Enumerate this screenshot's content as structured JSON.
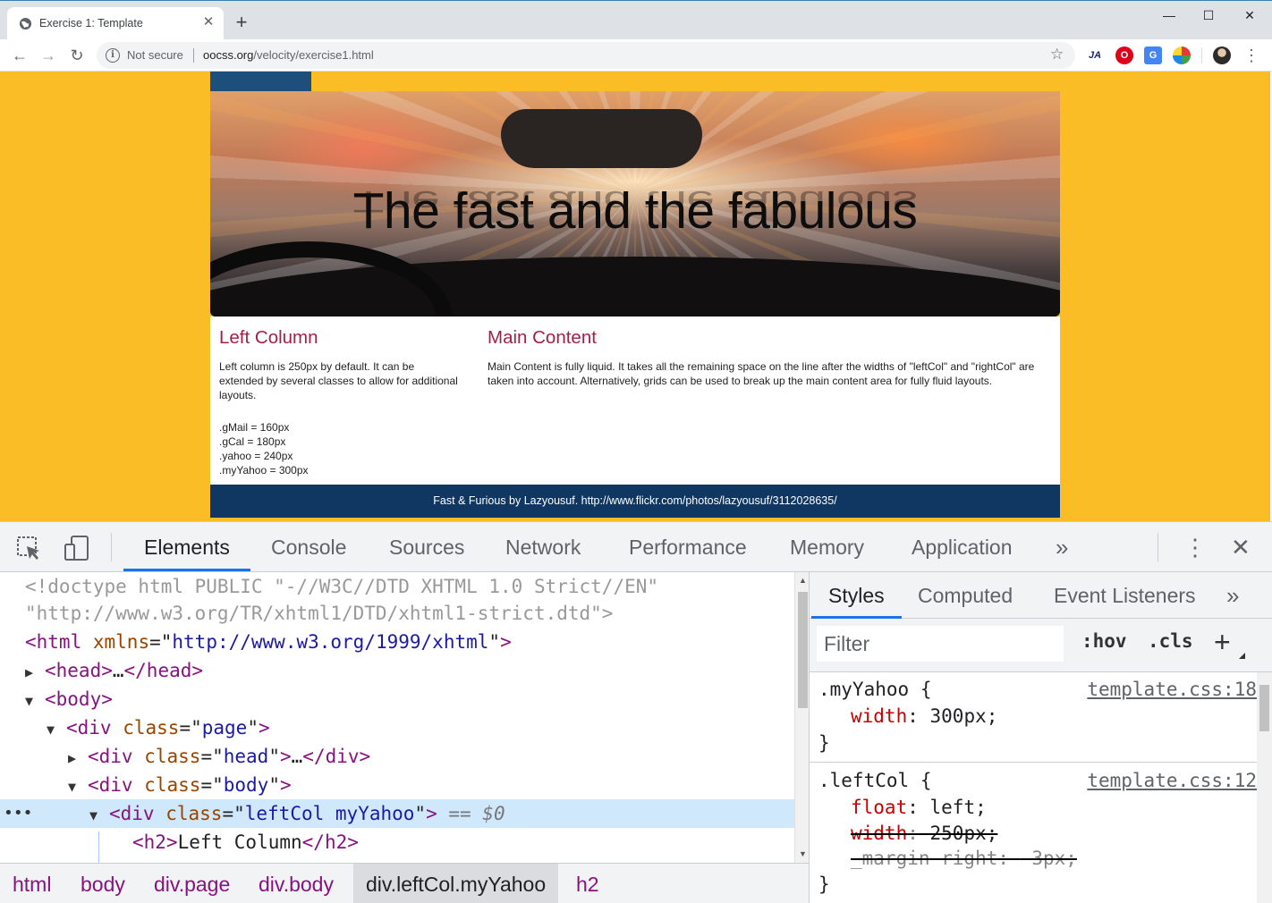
{
  "browser": {
    "tab_title": "Exercise 1: Template",
    "tab_close": "✕",
    "new_tab": "+",
    "window_controls": {
      "minimize": "—",
      "maximize": "☐",
      "close": "✕"
    },
    "not_secure": "Not secure",
    "url_domain": "oocss.org",
    "url_path": "/velocity/exercise1.html",
    "nav": {
      "back": "←",
      "forward": "→",
      "reload": "↻"
    },
    "star": "☆",
    "extensions": [
      {
        "name": "ja-extension-icon",
        "label": "JA",
        "color": "#1a237e",
        "bg": "#ffffff"
      },
      {
        "name": "opera-extension-icon",
        "label": "O",
        "color": "#ffffff",
        "bg": "#e0001a"
      },
      {
        "name": "translate-extension-icon",
        "label": "G",
        "color": "#ffffff",
        "bg": "#4285f4"
      },
      {
        "name": "color-extension-icon",
        "label": "●",
        "color": "#e53935",
        "bg": "#ffffff"
      }
    ],
    "menu": "⋮"
  },
  "page": {
    "banner_title": "The fast and the fabulous",
    "left_col": {
      "heading": "Left Column",
      "text": "Left column is 250px by default. It can be extended by several classes to allow for additional layouts.",
      "sizes": [
        ".gMail = 160px",
        ".gCal = 180px",
        ".yahoo = 240px",
        ".myYahoo = 300px"
      ]
    },
    "main": {
      "heading": "Main Content",
      "text": "Main Content is fully liquid. It takes all the remaining space on the line after the widths of \"leftCol\" and \"rightCol\" are taken into account. Alternatively, grids can be used to break up the main content area for fully fluid layouts."
    },
    "footer": "Fast & Furious by Lazyousuf. http://www.flickr.com/photos/lazyousuf/3112028635/",
    "colors": {
      "background": "#fbbd26",
      "heading": "#a51f45",
      "footer": "#0f3762",
      "head_tab": "#1d4f7d"
    }
  },
  "devtools": {
    "tabs": [
      "Elements",
      "Console",
      "Sources",
      "Network",
      "Performance",
      "Memory",
      "Application"
    ],
    "active_tab": "Elements",
    "more": "»",
    "kebab": "⋮",
    "close": "✕",
    "dom": {
      "doctype_1": "<!doctype html PUBLIC \"-//W3C//DTD XHTML 1.0 Strict//EN\"",
      "doctype_2": "\"http://www.w3.org/TR/xhtml1/DTD/xhtml1-strict.dtd\">",
      "html_xmlns": "http://www.w3.org/1999/xhtml",
      "ellipsis": "…",
      "head_class": "head",
      "page_class": "page",
      "body_class": "body",
      "selected_class": "leftCol myYahoo",
      "selected_marker": "== $0",
      "h2_text": "Left Column",
      "row_dots": "•••"
    },
    "breadcrumbs": [
      "html",
      "body",
      "div.page",
      "div.body",
      "div.leftCol.myYahoo",
      "h2"
    ],
    "styles": {
      "tabs": [
        "Styles",
        "Computed",
        "Event Listeners"
      ],
      "active_tab": "Styles",
      "more": "»",
      "filter_placeholder": "Filter",
      "hov": ":hov",
      "cls": ".cls",
      "plus": "+",
      "rules": [
        {
          "selector": ".myYahoo",
          "source": "template.css:18",
          "props": [
            {
              "name": "width",
              "value": "300px;"
            }
          ]
        },
        {
          "selector": ".leftCol",
          "source": "template.css:12",
          "props": [
            {
              "name": "float",
              "value": "left;"
            },
            {
              "name": "width",
              "value": "250px;"
            },
            {
              "name": "_margin-right",
              "value": "-3px;"
            }
          ]
        }
      ]
    }
  }
}
